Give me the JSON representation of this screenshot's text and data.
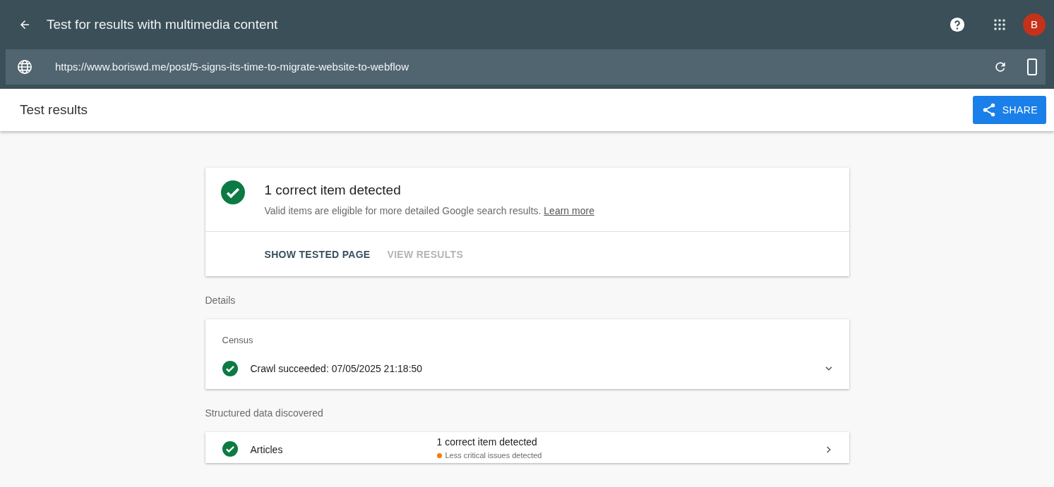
{
  "appbar": {
    "title": "Test for results with multimedia content",
    "avatar": "B"
  },
  "url_bar": {
    "url": "https://www.boriswd.me/post/5-signs-its-time-to-migrate-website-to-webflow"
  },
  "subheader": {
    "title": "Test results",
    "share_button": "SHARE"
  },
  "summary": {
    "headline": "1 correct item detected",
    "description": "Valid items are eligible for more detailed Google search results.",
    "link": "Learn more",
    "actions": [
      {
        "label": "SHOW TESTED PAGE",
        "disabled": false
      },
      {
        "label": "VIEW RESULTS",
        "disabled": true
      }
    ]
  },
  "details_label": "Details",
  "census": {
    "label": "Census",
    "text": "Crawl succeeded: 07/05/2025 21:18:50",
    "expanded": false
  },
  "structured_label": "Structured data discovered",
  "structured_items": [
    {
      "name": "Articles",
      "summary": "1 correct item detected",
      "note": "Less critical issues detected",
      "color": "#f57c00"
    }
  ]
}
